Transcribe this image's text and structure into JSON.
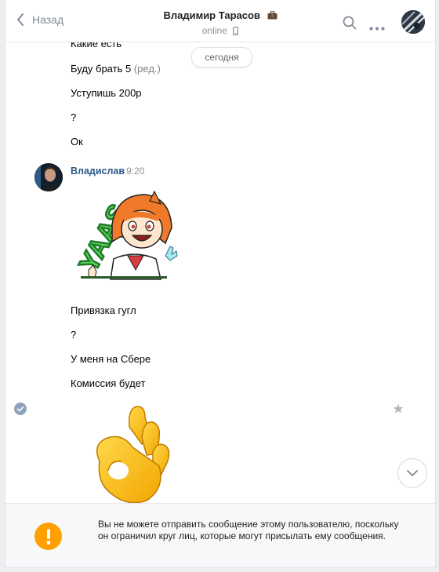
{
  "header": {
    "back_label": "Назад",
    "title": "Владимир Тарасов",
    "status": "online"
  },
  "date_pill": "сегодня",
  "messages_top": [
    {
      "text": "Какие есть"
    },
    {
      "text": "Буду брать 5",
      "edit": "(ред.)"
    },
    {
      "text": "Уступишь 200р"
    },
    {
      "text": "?"
    },
    {
      "text": "Ок"
    }
  ],
  "author": {
    "name": "Владислав",
    "time": "9:20"
  },
  "sticker_text": "YAAS",
  "messages_bottom": [
    {
      "text": "Привязка гугл"
    },
    {
      "text": "?"
    },
    {
      "text": "У меня на Сбере"
    },
    {
      "text": "Комиссия будет"
    }
  ],
  "notice": {
    "text": "Вы не можете отправить сообщение этому пользователю, поскольку он ограничил круг лиц, которые могут присылать ему сообщения."
  },
  "colors": {
    "link": "#2a5885",
    "warning": "#ffa000",
    "muted": "#828a99"
  }
}
